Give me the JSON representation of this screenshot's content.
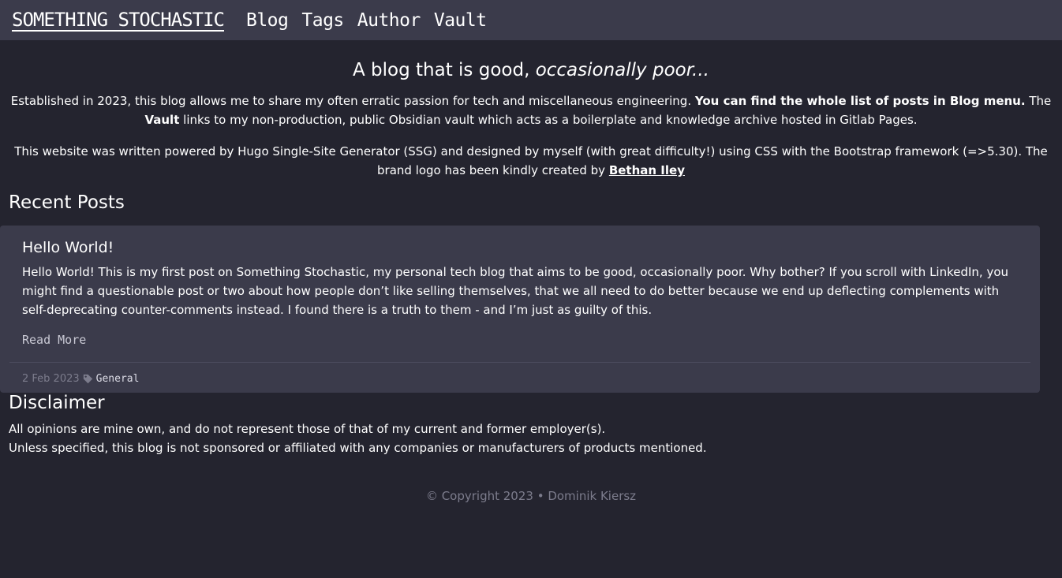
{
  "nav": {
    "brand": "SOMETHING STOCHASTIC",
    "links": [
      "Blog",
      "Tags",
      "Author",
      "Vault"
    ]
  },
  "intro": {
    "tagline_main": "A blog that is good,",
    "tagline_em": "occasionally poor...",
    "para1_a": "Established in 2023, this blog allows me to share my often erratic passion for tech and miscellaneous engineering.",
    "para1_bold": "You can find the whole list of posts in Blog menu.",
    "para1_b": "The",
    "para1_vault": "Vault",
    "para1_c": "links to my non-production, public Obsidian vault which acts as a boilerplate and knowledge archive hosted in Gitlab Pages.",
    "para2_a": "This website was written powered by Hugo Single-Site Generator (SSG) and designed by myself (with great difficulty!) using CSS with the Bootstrap framework (=>5.30). The brand logo has been kindly created by",
    "para2_link": "Bethan Iley"
  },
  "recent": {
    "heading": "Recent Posts",
    "posts": [
      {
        "title": "Hello World!",
        "excerpt": "Hello World! This is my first post on Something Stochastic, my personal tech blog that aims to be good, occasionally poor. Why bother? If you scroll with LinkedIn, you might find a questionable post or two about how people don’t like selling themselves, that we all need to do better because we end up deflecting complements with self-deprecating counter-comments instead. I found there is a truth to them - and I’m just as guilty of this.",
        "read_more": "Read More",
        "date": "2 Feb 2023",
        "tag": "General"
      }
    ]
  },
  "disclaimer": {
    "heading": "Disclaimer",
    "line1": "All opinions are mine own, and do not represent those of that of my current and former employer(s).",
    "line2": "Unless specified, this blog is not sponsored or affiliated with any companies or manufacturers of products mentioned."
  },
  "footer": {
    "text": "© Copyright 2023 • Dominik Kiersz"
  },
  "icons": {
    "tag": "tag-icon"
  },
  "colors": {
    "background": "#24242f",
    "navbar": "#3b3b4b",
    "card": "#3b3b4b",
    "muted": "#7c7c8c"
  }
}
